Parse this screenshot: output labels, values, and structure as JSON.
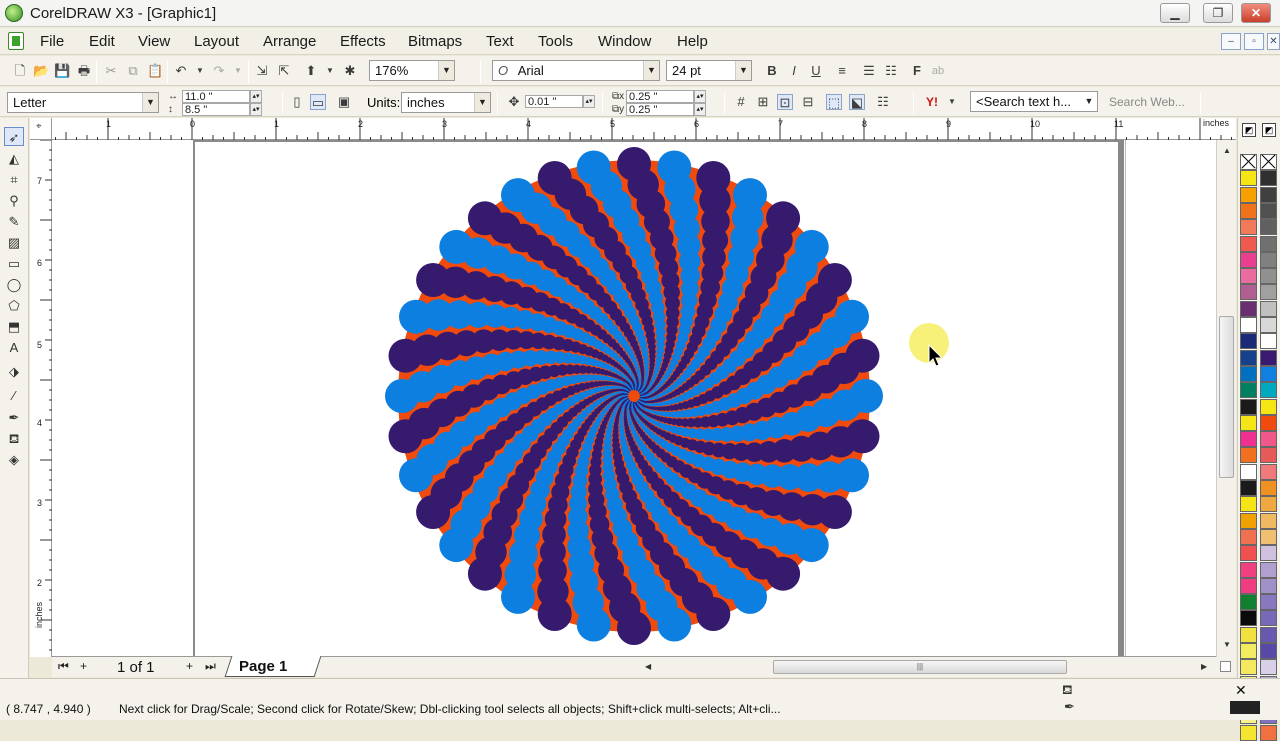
{
  "window": {
    "title": "CorelDRAW X3 - [Graphic1]",
    "minimize": "▁",
    "restore": "❐",
    "close": "✕"
  },
  "menu": {
    "items": [
      "File",
      "Edit",
      "View",
      "Layout",
      "Arrange",
      "Effects",
      "Bitmaps",
      "Text",
      "Tools",
      "Window",
      "Help"
    ],
    "mdi_min": "–",
    "mdi_restore": "▫",
    "mdi_close": "✕"
  },
  "toolbar1": {
    "zoom": "176%",
    "font": "Arial",
    "font_size": "24 pt"
  },
  "toolbar2": {
    "paper": "Letter",
    "width": "11.0 \"",
    "height": "8.5 \"",
    "units_label": "Units:",
    "units": "inches",
    "nudge": "0.01 \"",
    "dup_x": "0.25 \"",
    "dup_y": "0.25 \"",
    "search_placeholder": "<Search text h...",
    "search_web": "Search Web..."
  },
  "ruler": {
    "unit": "inches",
    "h_labels": [
      "1",
      "0",
      "1",
      "2",
      "3",
      "4",
      "5",
      "6",
      "7",
      "8",
      "9",
      "10",
      "11"
    ],
    "v_labels": [
      "7",
      "6",
      "5",
      "4",
      "3",
      "2"
    ]
  },
  "pages": {
    "count": "1 of 1",
    "tab": "Page 1"
  },
  "status": {
    "coords": "( 8.747 , 4.940  )",
    "hint": "Next click for Drag/Scale; Second click for Rotate/Skew; Dbl-clicking tool selects all objects; Shift+click multi-selects; Alt+cli..."
  },
  "colors": {
    "spiral_light": "#0c7fe0",
    "spiral_dark": "#351a6e",
    "spiral_bg": "#f04a0c",
    "cursor_highlight": "#f6ef6c"
  },
  "palette": {
    "left": [
      "none",
      "#f5e514",
      "#f6a100",
      "#f0731c",
      "#f07a5a",
      "#ef5a50",
      "#e8408e",
      "#e86ca0",
      "#b06090",
      "#6a2f70",
      "#ffffff",
      "#1a2a78",
      "#15408c",
      "#0070c0",
      "#008060",
      "#1a1a1a",
      "#f5e514",
      "#f03090",
      "#f07020",
      "#ffffff",
      "#1a1a1a",
      "#f5e514",
      "#f0a000",
      "#f07050",
      "#f05050",
      "#f04080",
      "#f03c80",
      "#108030",
      "#0a0a0a",
      "#f0e040",
      "#f4ec60",
      "#f3e860",
      "#f6f07a",
      "#f8f080",
      "#f9f090",
      "#f5e530"
    ],
    "right": [
      "none",
      "#303030",
      "#404040",
      "#505050",
      "#606060",
      "#707070",
      "#808080",
      "#909090",
      "#a0a0a0",
      "#c0c0c0",
      "#d8d8d8",
      "#ffffff",
      "#3a1a70",
      "#1080e0",
      "#00a8c0",
      "#f5e514",
      "#f04a0c",
      "#f0588c",
      "#e65a5a",
      "#f07a7a",
      "#f09020",
      "#f0a840",
      "#f0b860",
      "#f0c070",
      "#d0c0e0",
      "#b0a0d0",
      "#a090c8",
      "#8878c0",
      "#7868b8",
      "#6858b0",
      "#5848a8",
      "#d8d0e8",
      "#b8b0d8",
      "#9890c8",
      "#8070c0",
      "#f07040"
    ]
  }
}
